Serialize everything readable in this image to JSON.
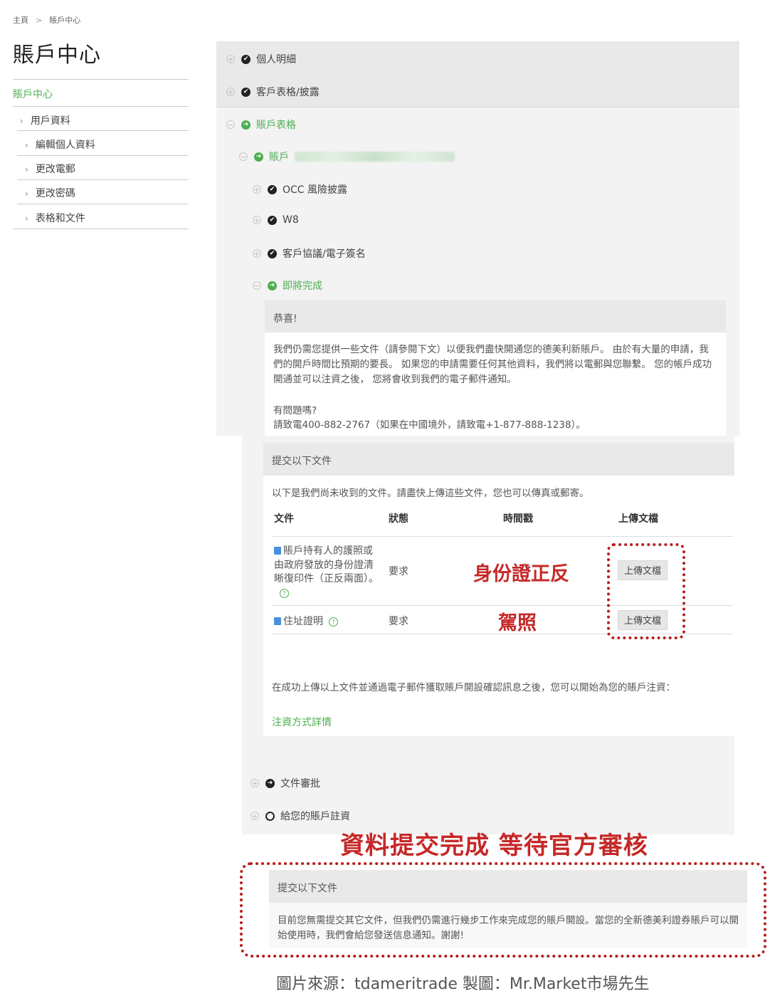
{
  "breadcrumb": {
    "home": "主頁",
    "current": "賬戶中心"
  },
  "page_title": "賬戶中心",
  "sidebar": {
    "active": "賬戶中心",
    "items": [
      {
        "label": "用戶資料"
      },
      {
        "label": "編輯個人資料"
      },
      {
        "label": "更改電郵"
      },
      {
        "label": "更改密碼"
      },
      {
        "label": "表格和文件"
      }
    ]
  },
  "accordion": {
    "personal": "個人明細",
    "client_forms": "客戶表格/披露",
    "account_forms": "賬戶表格",
    "account_prefix": "賬戶",
    "occ": "OCC 風險披露",
    "w8": "W8",
    "agreement": "客戶協議/電子簽名",
    "almost_done": "即將完成",
    "doc_review": "文件審批",
    "fund": "給您的賬戶註資"
  },
  "congrats": {
    "title": "恭喜!",
    "body": "我們仍需您提供一些文件（請參閱下文）以便我們盡快開通您的德美利新賬戶。 由於有大量的申請，我們的開戶時間比預期的要長。 如果您的申請需要任何其他資料，我們將以電郵與您聯繫。 您的帳戶成功開通並可以注資之後， 您將會收到我們的電子郵件通知。",
    "question": "有問題嗎?",
    "phone": "請致電400-882-2767（如果在中國境外，請致電+1-877-888-1238）。"
  },
  "submit": {
    "title": "提交以下文件",
    "intro": "以下是我們尚未收到的文件。請盡快上傳這些文件，您也可以傳真或郵寄。",
    "headers": {
      "doc": "文件",
      "status": "狀態",
      "timestamp": "時間戳",
      "upload": "上傳文檔"
    },
    "rows": [
      {
        "doc": "賬戶持有人的護照或由政府發放的身份證清晰復印件（正反兩面）。",
        "status": "要求",
        "button": "上傳文檔"
      },
      {
        "doc": "住址證明",
        "status": "要求",
        "button": "上傳文檔"
      }
    ],
    "after_text": "在成功上傳以上文件並通過電子郵件獲取賬戶開設確認訊息之後，您可以開始為您的賬戶注資：",
    "funding_link": "注資方式詳情"
  },
  "annotations": {
    "id_card": "身份證正反",
    "license": "駕照",
    "waiting": "資料提交完成 等待官方審核",
    "source": "圖片來源：tdameritrade 製圖：Mr.Market市場先生"
  },
  "final_card": {
    "title": "提交以下文件",
    "body": "目前您無需提交其它文件，但我們仍需進行幾步工作來完成您的賬戶開設。當您的全新德美利證券賬戶可以開始使用時，我們會給您發送信息通知。謝謝!"
  }
}
